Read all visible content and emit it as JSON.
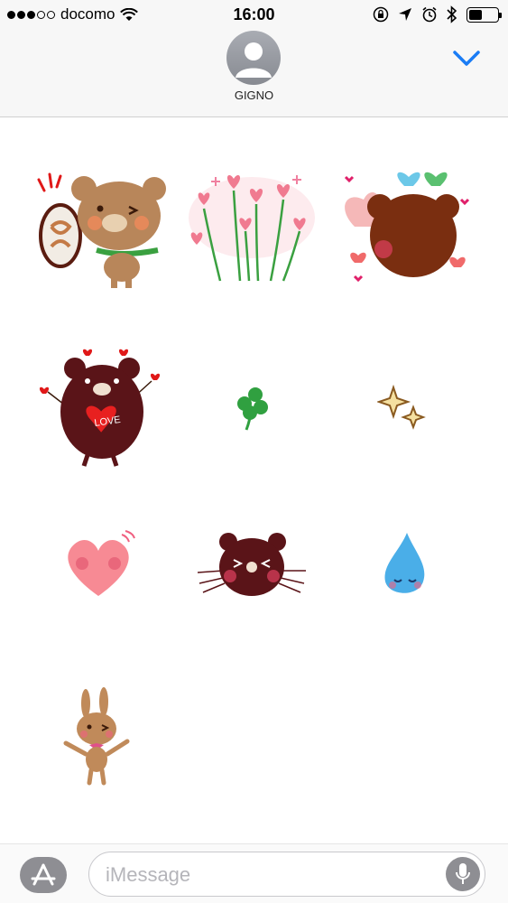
{
  "status_bar": {
    "carrier": "docomo",
    "time": "16:00",
    "signal_bars_filled": 3,
    "signal_bars_total": 5,
    "icons": [
      "wifi-icon",
      "lock-rotation-icon",
      "location-arrow-icon",
      "alarm-icon",
      "bluetooth-icon",
      "battery-icon"
    ],
    "battery_level": 0.45
  },
  "header": {
    "contact_name": "GIGNO",
    "avatar_icon": "person-silhouette-icon",
    "collapse_icon": "chevron-down-icon",
    "accent_color": "#1a7cf5"
  },
  "stickers": [
    {
      "name": "bear-with-coffee-sticker"
    },
    {
      "name": "heart-tulips-sticker"
    },
    {
      "name": "bear-back-hearts-sticker"
    },
    {
      "name": "bear-love-heart-sticker",
      "text": "LOVE"
    },
    {
      "name": "clover-sticker"
    },
    {
      "name": "sparkle-sticker"
    },
    {
      "name": "pink-heart-sticker"
    },
    {
      "name": "dark-bear-face-sticker"
    },
    {
      "name": "water-drop-sticker"
    },
    {
      "name": "bunny-sticker"
    }
  ],
  "input_bar": {
    "app_store_icon": "app-store-icon",
    "placeholder": "iMessage",
    "mic_icon": "microphone-icon"
  }
}
